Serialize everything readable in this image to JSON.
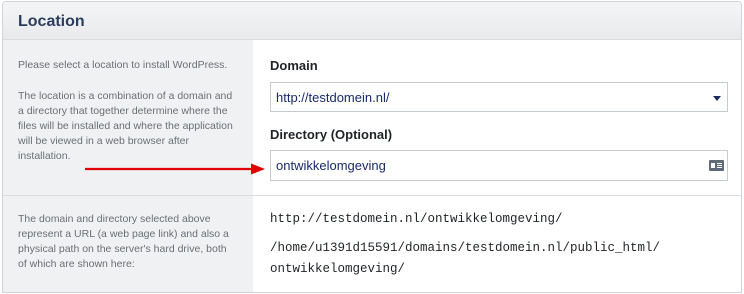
{
  "section": {
    "title": "Location"
  },
  "location_row": {
    "help_intro": "Please select a location to install WordPress.",
    "help_lines": [
      "The location is a combination of a domain and",
      "a directory that together determine where the",
      "files will be installed and where the application",
      "will be viewed in a web browser after",
      "installation."
    ],
    "domain_label": "Domain",
    "domain_value": "http://testdomein.nl/",
    "directory_label": "Directory (Optional)",
    "directory_value": "ontwikkelomgeving"
  },
  "summary_row": {
    "help_lines": [
      "The domain and directory selected above",
      "represent a URL (a web page link) and also a",
      "physical path on the server's hard drive, both",
      "of which are shown here:"
    ],
    "url": "http://testdomein.nl/ontwikkelomgeving/",
    "path_line1": "/home/u1391d15591/domains/testdomein.nl/public_html/",
    "path_line2": "ontwikkelomgeving/"
  },
  "icons": {
    "dropdown": "chevron-down-icon",
    "field": "id-card-icon",
    "annotation": "red-arrow"
  },
  "colors": {
    "title": "#2c3e5c",
    "value_text": "#1a2a6b",
    "arrow": "#e00000",
    "help_text": "#6a6f75"
  }
}
